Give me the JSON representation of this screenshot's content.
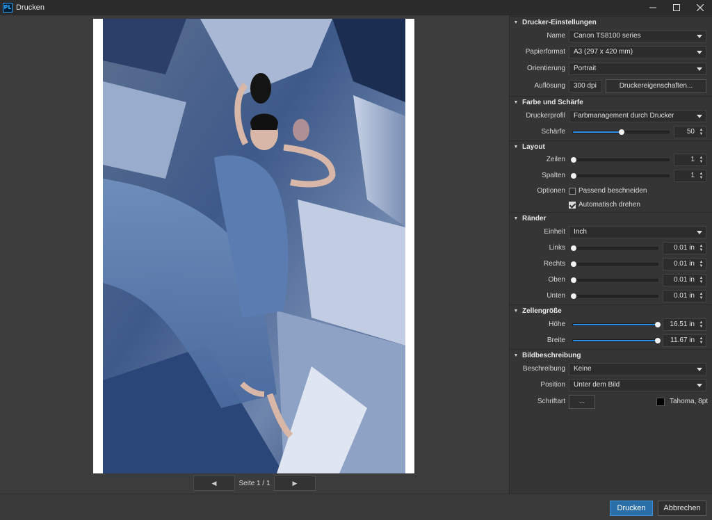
{
  "window": {
    "title": "Drucken",
    "app_logo": "PL"
  },
  "preview": {
    "page_indicator": "Seite 1 / 1",
    "prev_icon": "◀",
    "next_icon": "▶"
  },
  "printer_settings": {
    "header": "Drucker-Einstellungen",
    "name_label": "Name",
    "name_value": "Canon TS8100 series",
    "paper_label": "Papierformat",
    "paper_value": "A3 (297 x 420 mm)",
    "orientation_label": "Orientierung",
    "orientation_value": "Portrait",
    "resolution_label": "Auflösung",
    "resolution_value": "300 dpi",
    "properties_button": "Druckereigenschaften..."
  },
  "color_sharpness": {
    "header": "Farbe und Schärfe",
    "profile_label": "Druckerprofil",
    "profile_value": "Farbmanagement durch Drucker",
    "sharpness_label": "Schärfe",
    "sharpness_value": "50",
    "sharpness_fraction": 0.5
  },
  "layout": {
    "header": "Layout",
    "rows_label": "Zeilen",
    "rows_value": "1",
    "columns_label": "Spalten",
    "columns_value": "1",
    "options_label": "Optionen",
    "crop_label": "Passend beschneiden",
    "crop_checked": false,
    "rotate_label": "Automatisch drehen",
    "rotate_checked": true
  },
  "margins": {
    "header": "Ränder",
    "unit_label": "Einheit",
    "unit_value": "Inch",
    "left_label": "Links",
    "left_value": "0.01 in",
    "right_label": "Rechts",
    "right_value": "0.01 in",
    "top_label": "Oben",
    "top_value": "0.01 in",
    "bottom_label": "Unten",
    "bottom_value": "0.01 in"
  },
  "cell_size": {
    "header": "Zellengröße",
    "height_label": "Höhe",
    "height_value": "16.51 in",
    "width_label": "Breite",
    "width_value": "11.67 in"
  },
  "caption": {
    "header": "Bildbeschreibung",
    "description_label": "Beschreibung",
    "description_value": "Keine",
    "position_label": "Position",
    "position_value": "Unter dem Bild",
    "font_label": "Schriftart",
    "font_button": "...",
    "font_value": "Tahoma, 8pt",
    "font_color": "#000000"
  },
  "footer": {
    "print_button": "Drucken",
    "cancel_button": "Abbrechen"
  },
  "colors": {
    "accent": "#2f8de4",
    "primary_button": "#2a6fa8",
    "panel_bg": "#353535"
  }
}
